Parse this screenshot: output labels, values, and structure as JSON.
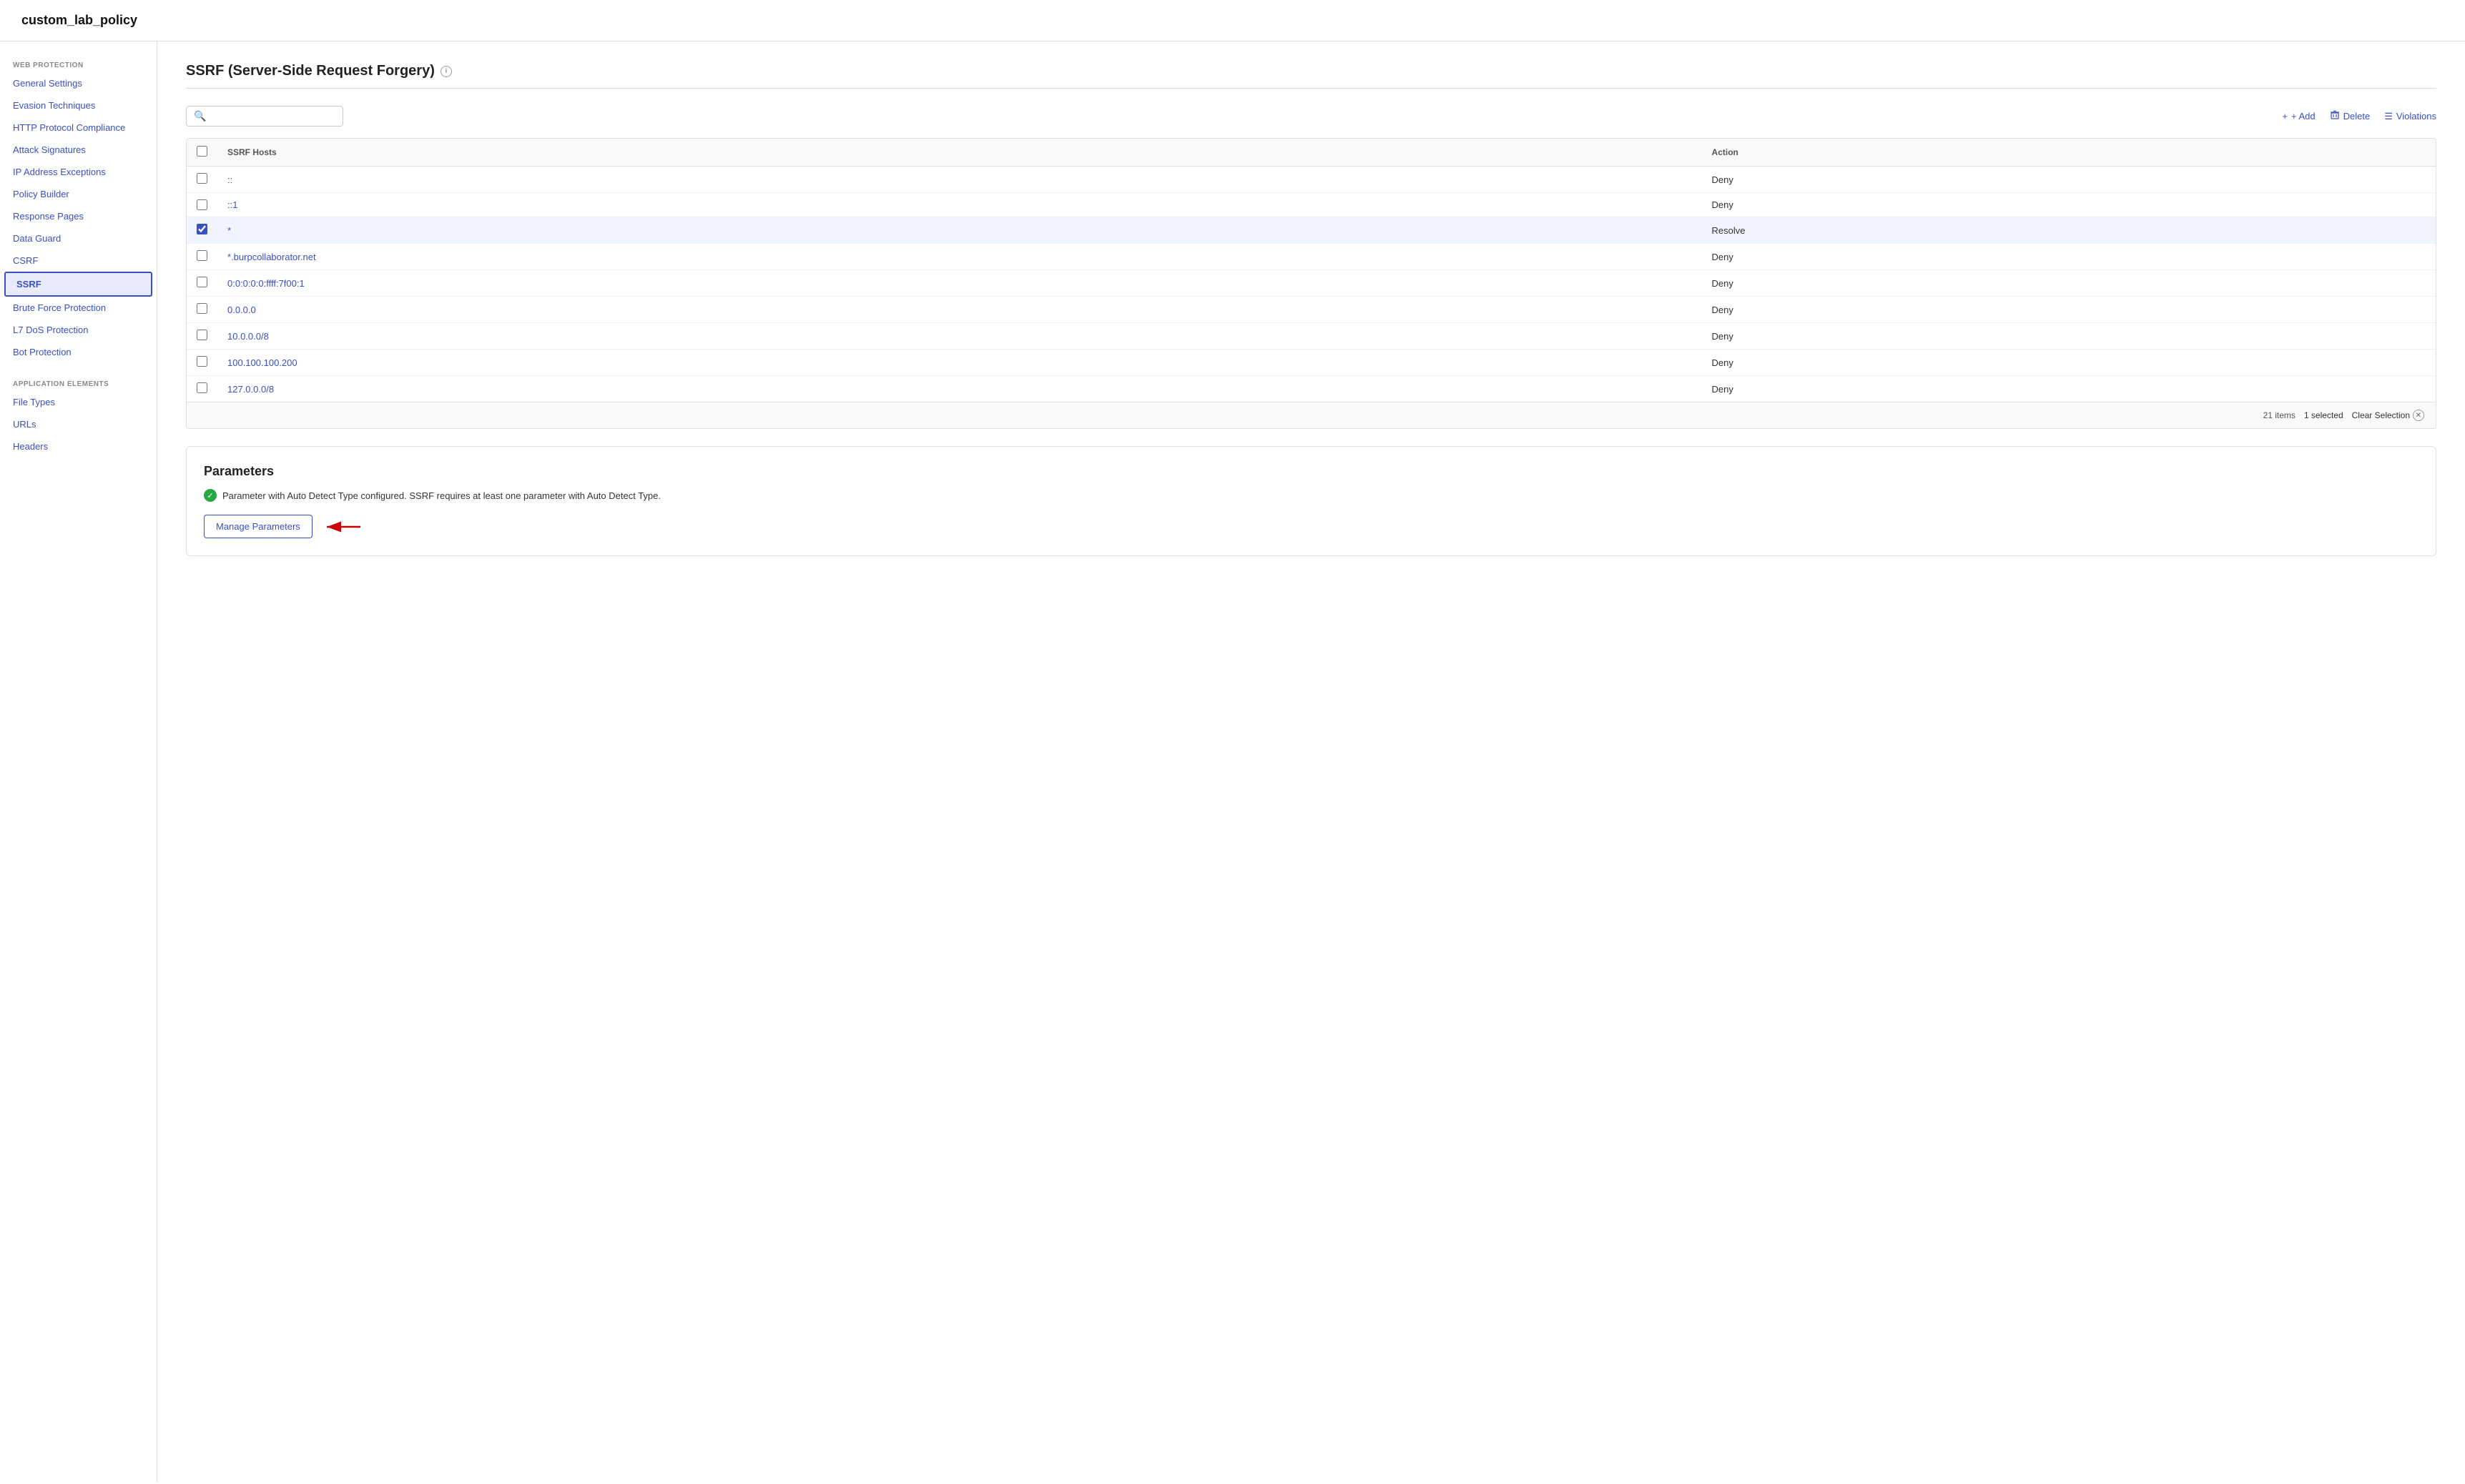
{
  "app": {
    "title": "custom_lab_policy"
  },
  "sidebar": {
    "web_protection_label": "WEB PROTECTION",
    "items": [
      {
        "id": "general-settings",
        "label": "General Settings",
        "active": false
      },
      {
        "id": "evasion-techniques",
        "label": "Evasion Techniques",
        "active": false
      },
      {
        "id": "http-protocol-compliance",
        "label": "HTTP Protocol Compliance",
        "active": false
      },
      {
        "id": "attack-signatures",
        "label": "Attack Signatures",
        "active": false
      },
      {
        "id": "ip-address-exceptions",
        "label": "IP Address Exceptions",
        "active": false
      },
      {
        "id": "policy-builder",
        "label": "Policy Builder",
        "active": false
      },
      {
        "id": "response-pages",
        "label": "Response Pages",
        "active": false
      },
      {
        "id": "data-guard",
        "label": "Data Guard",
        "active": false
      },
      {
        "id": "csrf",
        "label": "CSRF",
        "active": false
      },
      {
        "id": "ssrf",
        "label": "SSRF",
        "active": true
      },
      {
        "id": "brute-force-protection",
        "label": "Brute Force Protection",
        "active": false
      },
      {
        "id": "l7-dos-protection",
        "label": "L7 DoS Protection",
        "active": false
      },
      {
        "id": "bot-protection",
        "label": "Bot Protection",
        "active": false
      }
    ],
    "application_elements_label": "APPLICATION ELEMENTS",
    "app_items": [
      {
        "id": "file-types",
        "label": "File Types",
        "active": false
      },
      {
        "id": "urls",
        "label": "URLs",
        "active": false
      },
      {
        "id": "headers",
        "label": "Headers",
        "active": false
      }
    ]
  },
  "main": {
    "page_title": "SSRF (Server-Side Request Forgery)",
    "search_placeholder": "",
    "toolbar": {
      "add_label": "+ Add",
      "delete_label": "Delete",
      "violations_label": "Violations"
    },
    "table": {
      "col_hosts": "SSRF Hosts",
      "col_action": "Action",
      "rows": [
        {
          "id": 1,
          "host": "::",
          "action": "Deny",
          "checked": false,
          "arrow": false
        },
        {
          "id": 2,
          "host": "::1",
          "action": "Deny",
          "checked": false,
          "arrow": true
        },
        {
          "id": 3,
          "host": "*",
          "action": "Resolve",
          "checked": true,
          "arrow": false
        },
        {
          "id": 4,
          "host": "*.burpcollaborator.net",
          "action": "Deny",
          "checked": false,
          "arrow": false
        },
        {
          "id": 5,
          "host": "0:0:0:0:0:ffff:7f00:1",
          "action": "Deny",
          "checked": false,
          "arrow": false
        },
        {
          "id": 6,
          "host": "0.0.0.0",
          "action": "Deny",
          "checked": false,
          "arrow": false
        },
        {
          "id": 7,
          "host": "10.0.0.0/8",
          "action": "Deny",
          "checked": false,
          "arrow": false
        },
        {
          "id": 8,
          "host": "100.100.100.200",
          "action": "Deny",
          "checked": false,
          "arrow": false
        },
        {
          "id": 9,
          "host": "127.0.0.0/8",
          "action": "Deny",
          "checked": false,
          "arrow": false
        }
      ],
      "footer": {
        "items_count": "21 items",
        "selected_count": "1 selected",
        "clear_selection": "Clear Selection"
      }
    },
    "parameters": {
      "title": "Parameters",
      "info_text": "Parameter with Auto Detect Type configured. SSRF requires at least one parameter with Auto Detect Type.",
      "manage_button": "Manage Parameters"
    }
  }
}
